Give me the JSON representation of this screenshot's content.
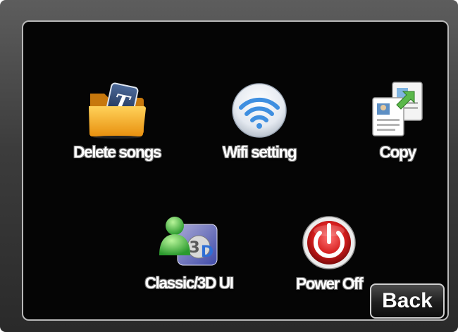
{
  "menu": {
    "items": [
      {
        "label": "Delete songs",
        "icon": "folder-t-icon"
      },
      {
        "label": "Wifi setting",
        "icon": "wifi-icon"
      },
      {
        "label": "Copy",
        "icon": "copy-documents-icon"
      },
      {
        "label": "Classic/3D UI",
        "icon": "user-3d-icon"
      },
      {
        "label": "Power Off",
        "icon": "power-icon"
      }
    ]
  },
  "back_label": "Back",
  "colors": {
    "screen_background": "#050505",
    "bezel": "#4a4a4a",
    "label_text": "#ffffff",
    "wifi_blue": "#3f8fe0",
    "power_red": "#d41c1c",
    "folder_orange": "#f0a21c"
  }
}
